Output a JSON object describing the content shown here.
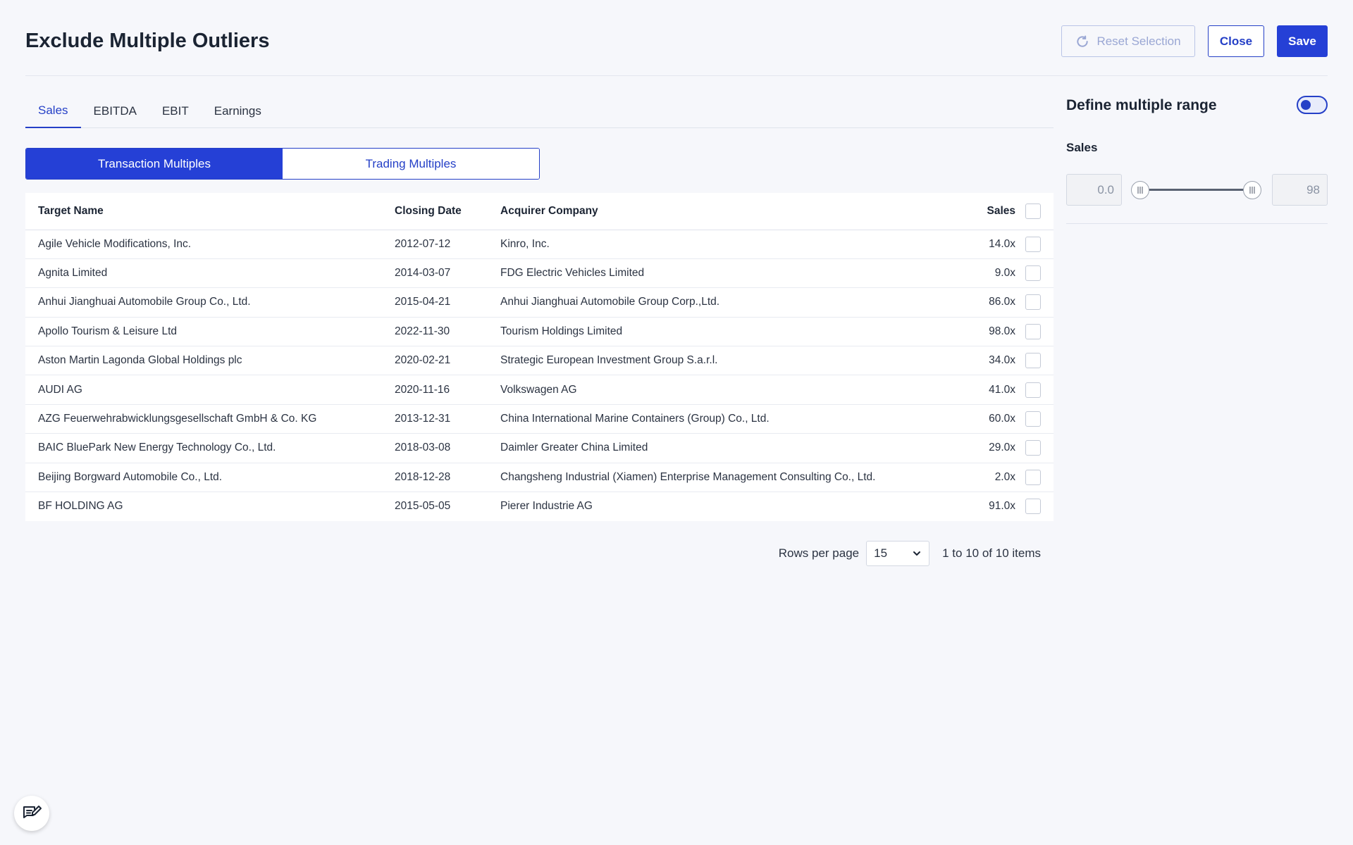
{
  "header": {
    "title": "Exclude Multiple Outliers",
    "reset_label": "Reset Selection",
    "close_label": "Close",
    "save_label": "Save"
  },
  "tabs": [
    {
      "label": "Sales",
      "active": true
    },
    {
      "label": "EBITDA",
      "active": false
    },
    {
      "label": "EBIT",
      "active": false
    },
    {
      "label": "Earnings",
      "active": false
    }
  ],
  "segmented": {
    "transaction_label": "Transaction Multiples",
    "trading_label": "Trading Multiples"
  },
  "table": {
    "columns": {
      "target": "Target Name",
      "date": "Closing Date",
      "acquirer": "Acquirer Company",
      "sales": "Sales"
    },
    "rows": [
      {
        "target": "Agile Vehicle Modifications, Inc.",
        "date": "2012-07-12",
        "acquirer": "Kinro, Inc.",
        "sales": "14.0x"
      },
      {
        "target": "Agnita Limited",
        "date": "2014-03-07",
        "acquirer": "FDG Electric Vehicles Limited",
        "sales": "9.0x"
      },
      {
        "target": "Anhui Jianghuai Automobile Group Co., Ltd.",
        "date": "2015-04-21",
        "acquirer": "Anhui Jianghuai Automobile Group Corp.,Ltd.",
        "sales": "86.0x"
      },
      {
        "target": "Apollo Tourism & Leisure Ltd",
        "date": "2022-11-30",
        "acquirer": "Tourism Holdings Limited",
        "sales": "98.0x"
      },
      {
        "target": "Aston Martin Lagonda Global Holdings plc",
        "date": "2020-02-21",
        "acquirer": "Strategic European Investment Group S.a.r.l.",
        "sales": "34.0x"
      },
      {
        "target": "AUDI AG",
        "date": "2020-11-16",
        "acquirer": "Volkswagen AG",
        "sales": "41.0x"
      },
      {
        "target": "AZG Feuerwehrabwicklungsgesellschaft GmbH & Co. KG",
        "date": "2013-12-31",
        "acquirer": "China International Marine Containers (Group) Co., Ltd.",
        "sales": "60.0x"
      },
      {
        "target": "BAIC BluePark New Energy Technology Co., Ltd.",
        "date": "2018-03-08",
        "acquirer": "Daimler Greater China Limited",
        "sales": "29.0x"
      },
      {
        "target": "Beijing Borgward Automobile Co., Ltd.",
        "date": "2018-12-28",
        "acquirer": "Changsheng Industrial (Xiamen) Enterprise Management Consulting Co., Ltd.",
        "sales": "2.0x"
      },
      {
        "target": "BF HOLDING AG",
        "date": "2015-05-05",
        "acquirer": "Pierer Industrie AG",
        "sales": "91.0x"
      }
    ]
  },
  "pagination": {
    "rows_per_page_label": "Rows per page",
    "rows_per_page_value": "15",
    "summary": "1 to 10 of 10 items"
  },
  "range": {
    "title": "Define multiple range",
    "toggle_on": true,
    "label": "Sales",
    "min": "0.0",
    "max": "98"
  },
  "colors": {
    "accent": "#2540d6",
    "background": "#f6f7fb"
  },
  "icons": {
    "reset": "refresh-icon",
    "dropdown": "chevron-down-icon",
    "feedback": "feedback-edit-icon",
    "slider_handle": "grip-lines-icon"
  }
}
